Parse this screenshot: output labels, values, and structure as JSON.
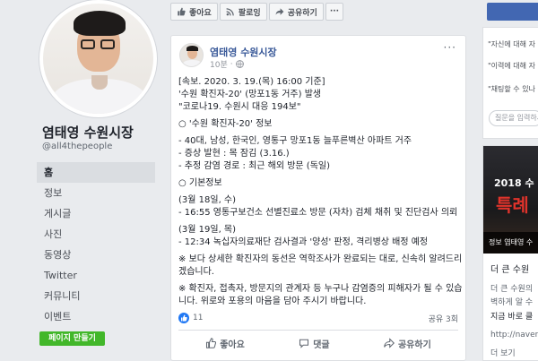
{
  "profile": {
    "name": "염태영 수원시장",
    "handle": "@all4thepeople",
    "nav": [
      "홈",
      "정보",
      "게시글",
      "사진",
      "동영상",
      "Twitter",
      "커뮤니티",
      "이벤트"
    ],
    "create_page": "페이지 만들기"
  },
  "actionbar": {
    "like": "좋아요",
    "follow": "팔로잉",
    "share": "공유하기",
    "more": "···"
  },
  "post": {
    "author": "염태영 수원시장",
    "time": "10분",
    "paragraphs": [
      [
        "[속보. 2020. 3. 19.(목) 16:00 기준]",
        "'수원 확진자-20' (망포1동 거주) 발생",
        "\"코로나19. 수원시 대응 194보\""
      ],
      [
        "○ '수원 확진자-20' 정보"
      ],
      [
        "- 40대, 남성, 한국인, 영통구 망포1동 늘푸른벽산 아파트 거주",
        "- 증상 발현 : 목 잠김 (3.16.)",
        "- 추정 감염 경로 : 최근 해외 방문 (독일)"
      ],
      [
        "○ 기본정보"
      ],
      [
        "(3월 18일, 수)",
        "- 16:55 영통구보건소 선별진료소 방문 (자차) 검체 채취 및 진단검사 의뢰"
      ],
      [
        "(3월 19일, 목)",
        "- 12:34 녹십자의료재단 검사결과 '양성' 판정, 격리병상 배정 예정"
      ],
      [
        "※ 보다 상세한 확진자의 동선은 역학조사가 완료되는 대로, 신속히 알려드리겠습니다."
      ],
      [
        "※ 확진자, 접촉자, 방문지의 관계자 등 누구나 감염증의 피해자가 될 수 있습니다. 위로와 포용의 마음을 담아 주시기 바랍니다."
      ]
    ],
    "like_count": "11",
    "share_count": "공유 3회",
    "actions": {
      "like": "좋아요",
      "comment": "댓글",
      "share": "공유하기"
    }
  },
  "sidebar_right": {
    "questions": [
      "\"자신에 대해 자",
      "\"이력에 대해 자",
      "\"채팅할 수 있나"
    ],
    "question_placeholder": "질문을 입력하세요",
    "ad": {
      "year": "2018 수",
      "big": "특례",
      "strip": "정보 염태영 수",
      "line1": "더 큰 수원",
      "line2": "더 큰 수원의",
      "line3": "벽하게 알 수",
      "line4": "지금 바로 클",
      "line5": "http://naver.",
      "line6": "더 보기"
    }
  },
  "colors": {
    "accent": "#4267b2",
    "link": "#385898",
    "green": "#42b72a"
  }
}
